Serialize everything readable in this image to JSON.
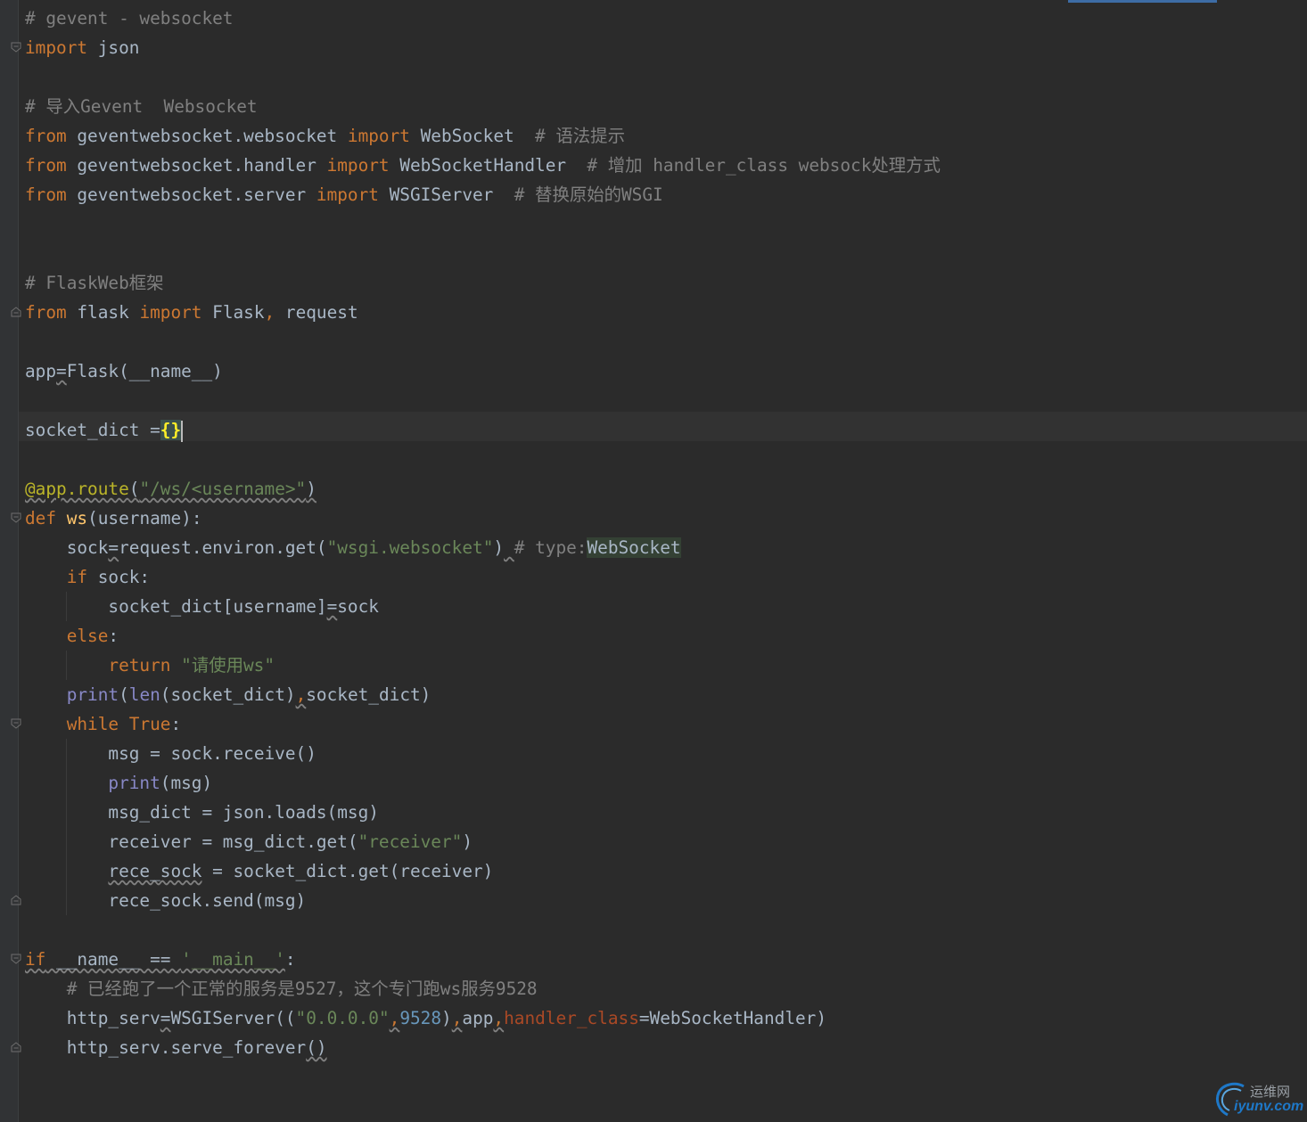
{
  "editor": {
    "language": "python",
    "theme_colors": {
      "background": "#2b2b2b",
      "text": "#a9b7c6",
      "keyword": "#cc7832",
      "comment": "#808080",
      "string": "#6a8759",
      "number": "#6897bb",
      "builtin": "#8888c6",
      "function": "#ffc66d",
      "decorator": "#bbb529",
      "kwarg": "#aa4926"
    },
    "current_line": 14,
    "lines": [
      [
        {
          "t": "# gevent - websocket",
          "c": "cm"
        }
      ],
      [
        {
          "t": "import",
          "c": "kw"
        },
        {
          "t": " json"
        }
      ],
      [],
      [
        {
          "t": "# 导入Gevent  Websocket",
          "c": "cm"
        }
      ],
      [
        {
          "t": "from",
          "c": "kw"
        },
        {
          "t": " geventwebsocket.websocket "
        },
        {
          "t": "import",
          "c": "kw"
        },
        {
          "t": " WebSocket  "
        },
        {
          "t": "# 语法提示",
          "c": "cm"
        }
      ],
      [
        {
          "t": "from",
          "c": "kw"
        },
        {
          "t": " geventwebsocket.handler "
        },
        {
          "t": "import",
          "c": "kw"
        },
        {
          "t": " WebSocketHandler  "
        },
        {
          "t": "# 增加 handler_class websock处理方式",
          "c": "cm"
        }
      ],
      [
        {
          "t": "from",
          "c": "kw"
        },
        {
          "t": " geventwebsocket.server "
        },
        {
          "t": "import",
          "c": "kw"
        },
        {
          "t": " WSGIServer  "
        },
        {
          "t": "# 替换原始的WSGI",
          "c": "cm"
        }
      ],
      [],
      [],
      [
        {
          "t": "# FlaskWeb框架",
          "c": "cm"
        }
      ],
      [
        {
          "t": "from",
          "c": "kw"
        },
        {
          "t": " flask "
        },
        {
          "t": "import",
          "c": "kw"
        },
        {
          "t": " Flask"
        },
        {
          "t": ",",
          "c": "kw"
        },
        {
          "t": " request"
        }
      ],
      [],
      [
        {
          "t": "app"
        },
        {
          "t": "=",
          "c": "wavy"
        },
        {
          "t": "Flask(__name__)"
        }
      ],
      [],
      [
        {
          "t": "socket_dict ="
        },
        {
          "t": "{}",
          "c": "brace"
        },
        {
          "t": "",
          "c": "caret"
        }
      ],
      [],
      [
        {
          "t": "@app.route",
          "c": "dec wavy"
        },
        {
          "t": "(",
          "c": "wavy"
        },
        {
          "t": "\"/ws/<username>\"",
          "c": "str wavy"
        },
        {
          "t": ")",
          "c": "wavy"
        }
      ],
      [
        {
          "t": "def",
          "c": "kw"
        },
        {
          "t": " "
        },
        {
          "t": "ws",
          "c": "fn"
        },
        {
          "t": "(username):"
        }
      ],
      [
        {
          "t": "    sock"
        },
        {
          "t": "=",
          "c": "wavy"
        },
        {
          "t": "request.environ.get("
        },
        {
          "t": "\"wsgi.websocket\"",
          "c": "str"
        },
        {
          "t": ")"
        },
        {
          "t": " ",
          "c": "wavy"
        },
        {
          "t": "# type:",
          "c": "cm"
        },
        {
          "t": "WebSocket",
          "c": "hl"
        }
      ],
      [
        {
          "t": "    "
        },
        {
          "t": "if",
          "c": "kw"
        },
        {
          "t": " sock:"
        }
      ],
      [
        {
          "t": "        socket_dict[username]"
        },
        {
          "t": "=",
          "c": "wavy"
        },
        {
          "t": "sock"
        }
      ],
      [
        {
          "t": "    "
        },
        {
          "t": "else",
          "c": "kw"
        },
        {
          "t": ":"
        }
      ],
      [
        {
          "t": "        "
        },
        {
          "t": "return",
          "c": "kw"
        },
        {
          "t": " "
        },
        {
          "t": "\"请使用ws\"",
          "c": "str"
        }
      ],
      [
        {
          "t": "    "
        },
        {
          "t": "print",
          "c": "bi"
        },
        {
          "t": "("
        },
        {
          "t": "len",
          "c": "bi"
        },
        {
          "t": "(socket_dict)"
        },
        {
          "t": ",",
          "c": "kw wavy"
        },
        {
          "t": "socket_dict)"
        }
      ],
      [
        {
          "t": "    "
        },
        {
          "t": "while",
          "c": "kw"
        },
        {
          "t": " "
        },
        {
          "t": "True",
          "c": "kw"
        },
        {
          "t": ":"
        }
      ],
      [
        {
          "t": "        msg = sock.receive()"
        }
      ],
      [
        {
          "t": "        "
        },
        {
          "t": "print",
          "c": "bi"
        },
        {
          "t": "(msg)"
        }
      ],
      [
        {
          "t": "        msg_dict = json.loads(msg)"
        }
      ],
      [
        {
          "t": "        receiver = msg_dict.get("
        },
        {
          "t": "\"receiver\"",
          "c": "str"
        },
        {
          "t": ")"
        }
      ],
      [
        {
          "t": "        "
        },
        {
          "t": "rece_sock",
          "c": "wavy"
        },
        {
          "t": " = socket_dict.get(receiver)"
        }
      ],
      [
        {
          "t": "        rece_sock.send(msg)"
        }
      ],
      [],
      [
        {
          "t": "if",
          "c": "kw wavy"
        },
        {
          "t": " __name__ == ",
          "c": "wavy"
        },
        {
          "t": "'__main__'",
          "c": "str wavy"
        },
        {
          "t": ":"
        }
      ],
      [
        {
          "t": "    "
        },
        {
          "t": "# 已经跑了一个正常的服务是9527，这个专门跑ws服务9528",
          "c": "cm"
        }
      ],
      [
        {
          "t": "    http_serv"
        },
        {
          "t": "=",
          "c": "wavy"
        },
        {
          "t": "WSGIServer(("
        },
        {
          "t": "\"0.0.0.0\"",
          "c": "str"
        },
        {
          "t": ",",
          "c": "kw wavy"
        },
        {
          "t": "9528",
          "c": "num"
        },
        {
          "t": ")"
        },
        {
          "t": ",",
          "c": "kw wavy"
        },
        {
          "t": "app"
        },
        {
          "t": ",",
          "c": "kw wavy"
        },
        {
          "t": "handler_class",
          "c": "kwarg"
        },
        {
          "t": "=WebSocketHandler)"
        }
      ],
      [
        {
          "t": "    http_serv.serve_forever"
        },
        {
          "t": "()",
          "c": "wavy"
        }
      ]
    ],
    "fold_markers": [
      {
        "line": 1,
        "kind": "open"
      },
      {
        "line": 10,
        "kind": "close"
      },
      {
        "line": 17,
        "kind": "open"
      },
      {
        "line": 24,
        "kind": "open"
      },
      {
        "line": 30,
        "kind": "close"
      },
      {
        "line": 32,
        "kind": "open"
      },
      {
        "line": 35,
        "kind": "close"
      }
    ],
    "indent_guides": [
      {
        "col": 1,
        "from": 20,
        "to": 20
      },
      {
        "col": 1,
        "from": 22,
        "to": 22
      },
      {
        "col": 1,
        "from": 25,
        "to": 30
      }
    ]
  },
  "watermark": {
    "site_cn": "运维网",
    "site_en": "iyunv.com"
  }
}
